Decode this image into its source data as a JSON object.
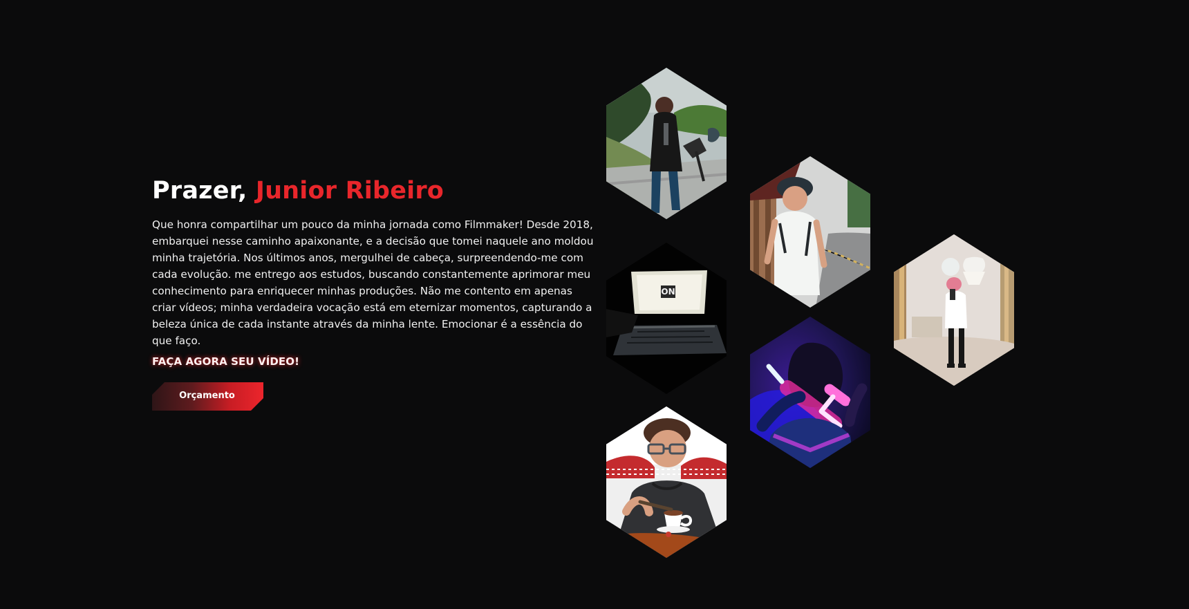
{
  "about": {
    "title_prefix": "Prazer, ",
    "title_name": "Junior Ribeiro",
    "text": "Que honra compartilhar um pouco da minha jornada como Filmmaker! Desde 2018, embarquei nesse caminho apaixonante, e a decisão que tomei naquele ano moldou minha trajetória. Nos últimos anos, mergulhei de cabeça, surpreendendo-me com cada evolução. me entrego aos estudos, buscando constantemente aprimorar meu conhecimento para enriquecer minhas produções. Não me contento em apenas criar vídeos; minha verdadeira vocação está em eternizar momentos, capturando a beleza única de cada instante através da minha lente. Emocionar é a essência do que faço."
  },
  "cta": {
    "label": "FAÇA AGORA SEU VÍDEO!",
    "button": "Orçamento"
  },
  "colors": {
    "background": "#0b0b0c",
    "accent": "#e8262b",
    "text": "#ffffff"
  },
  "gallery": {
    "icons": [
      "filmmaker-gimbal-photo-icon",
      "walking-portrait-photo-icon",
      "laptop-studio-photo-icon",
      "mirror-selfie-photo-icon",
      "neon-silhouette-photo-icon",
      "coffee-portrait-photo-icon"
    ]
  }
}
